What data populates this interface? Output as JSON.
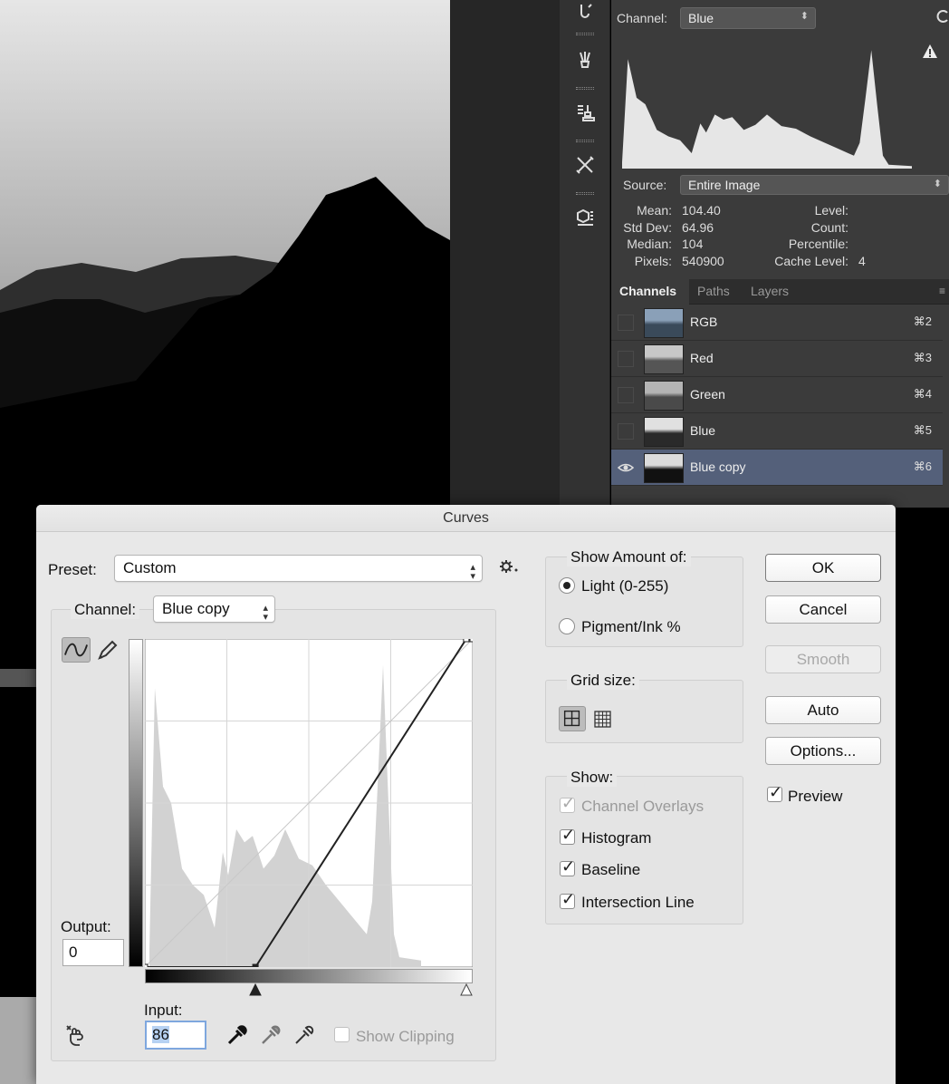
{
  "histogram_panel": {
    "channel_label": "Channel:",
    "channel_value": "Blue",
    "source_label": "Source:",
    "source_value": "Entire Image",
    "stats": {
      "mean_label": "Mean:",
      "mean": "104.40",
      "stddev_label": "Std Dev:",
      "stddev": "64.96",
      "median_label": "Median:",
      "median": "104",
      "pixels_label": "Pixels:",
      "pixels": "540900",
      "level_label": "Level:",
      "level": "",
      "count_label": "Count:",
      "count": "",
      "percentile_label": "Percentile:",
      "percentile": "",
      "cache_label": "Cache Level:",
      "cache": "4"
    }
  },
  "tabs": [
    "Channels",
    "Paths",
    "Layers"
  ],
  "channels": [
    {
      "name": "RGB",
      "shortcut": "⌘2",
      "selected": false
    },
    {
      "name": "Red",
      "shortcut": "⌘3",
      "selected": false
    },
    {
      "name": "Green",
      "shortcut": "⌘4",
      "selected": false
    },
    {
      "name": "Blue",
      "shortcut": "⌘5",
      "selected": false
    },
    {
      "name": "Blue copy",
      "shortcut": "⌘6",
      "selected": true
    }
  ],
  "curves": {
    "title": "Curves",
    "preset_label": "Preset:",
    "preset_value": "Custom",
    "channel_label": "Channel:",
    "channel_value": "Blue copy",
    "output_label": "Output:",
    "output_value": "0",
    "input_label": "Input:",
    "input_value": "86",
    "show_clipping": "Show Clipping",
    "show_clipping_checked": false,
    "curve_points": [
      [
        0,
        0
      ],
      [
        86,
        0
      ],
      [
        250,
        255
      ],
      [
        255,
        255
      ]
    ],
    "show_amount": {
      "title": "Show Amount of:",
      "light": "Light  (0-255)",
      "pigment": "Pigment/Ink %",
      "selected": "light"
    },
    "grid_size": {
      "title": "Grid size:",
      "selected": "simple"
    },
    "show": {
      "title": "Show:",
      "channel_overlays": "Channel Overlays",
      "histogram": "Histogram",
      "baseline": "Baseline",
      "intersection_line": "Intersection Line",
      "channel_overlays_checked": true,
      "channel_overlays_disabled": true,
      "histogram_checked": true,
      "baseline_checked": true,
      "intersection_line_checked": true
    },
    "buttons": {
      "ok": "OK",
      "cancel": "Cancel",
      "smooth": "Smooth",
      "auto": "Auto",
      "options": "Options..."
    },
    "preview_label": "Preview",
    "preview_checked": true
  },
  "colors": {
    "panel_bg": "#3b3b3b",
    "selection": "#54607a",
    "dialog_bg": "#e8e8e8",
    "focus": "#7ea7de"
  }
}
